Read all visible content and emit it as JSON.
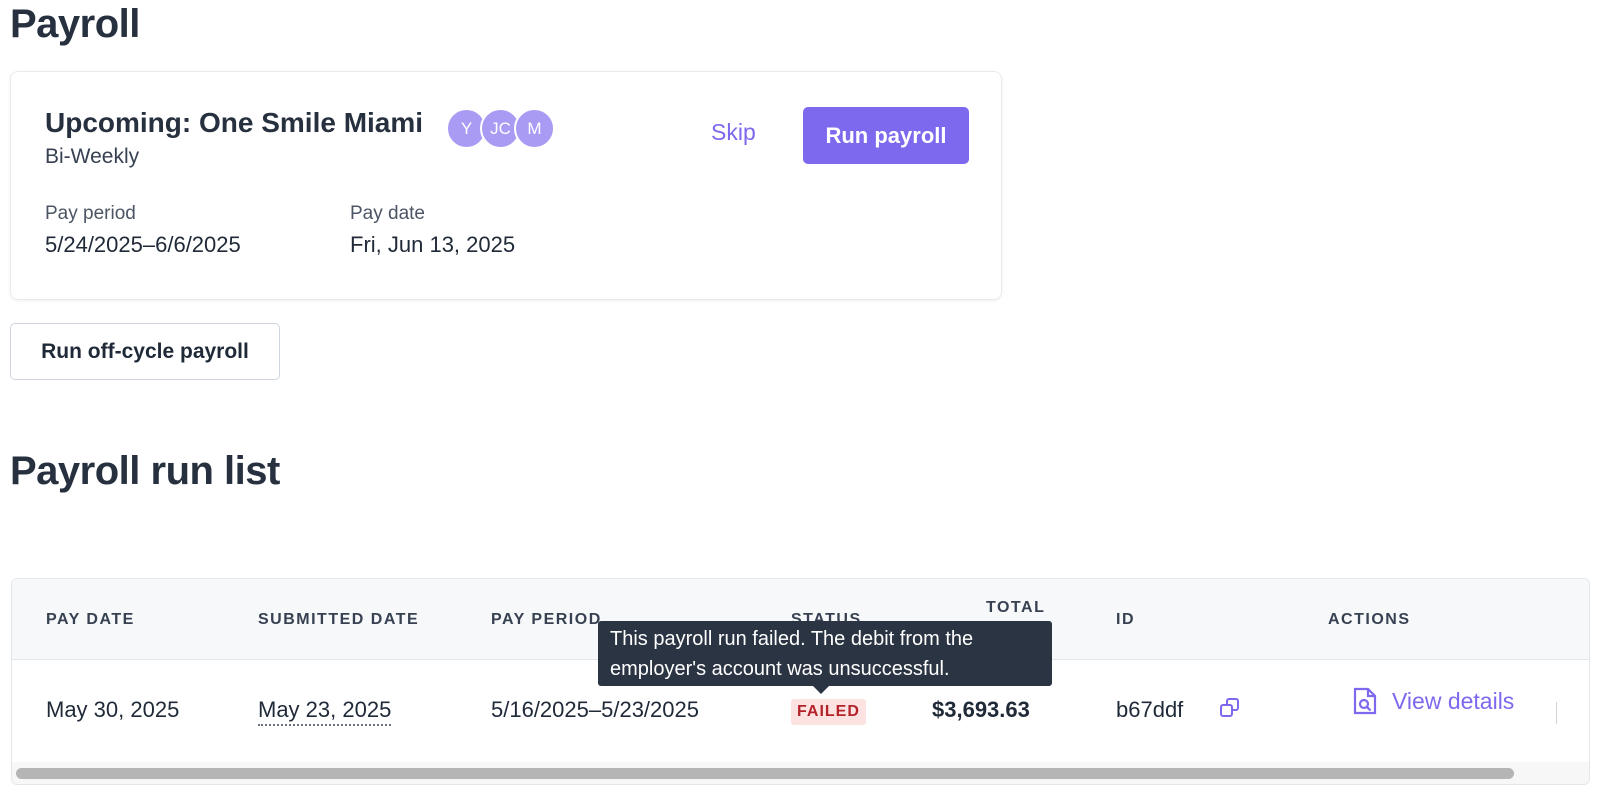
{
  "page": {
    "title": "Payroll"
  },
  "upcoming": {
    "title": "Upcoming: One Smile Miami",
    "frequency": "Bi-Weekly",
    "avatars": [
      "Y",
      "JC",
      "M"
    ],
    "skip_label": "Skip",
    "run_label": "Run payroll",
    "pay_period_label": "Pay period",
    "pay_period_value": "5/24/2025–6/6/2025",
    "pay_date_label": "Pay date",
    "pay_date_value": "Fri, Jun 13, 2025"
  },
  "offcycle": {
    "label": "Run off-cycle payroll"
  },
  "run_list": {
    "title": "Payroll run list",
    "columns": {
      "pay_date": "PAY DATE",
      "submitted_date": "SUBMITTED DATE",
      "pay_period": "PAY PERIOD",
      "status": "STATUS",
      "total": "TOTAL",
      "id": "ID",
      "actions": "ACTIONS"
    },
    "rows": [
      {
        "pay_date": "May 30, 2025",
        "submitted_date": "May 23, 2025",
        "pay_period": "5/16/2025–5/23/2025",
        "status": "FAILED",
        "total": "$3,693.63",
        "id": "b67ddf",
        "action_label": "View details"
      }
    ],
    "tooltip": {
      "line1": "This payroll run failed. The debit from the",
      "line2": "employer's account was unsuccessful."
    }
  },
  "colors": {
    "accent": "#7c69ee",
    "avatar": "#a99af3",
    "failed_bg": "#fde2e2",
    "failed_text": "#b4232a",
    "tooltip_bg": "#2b3443"
  }
}
